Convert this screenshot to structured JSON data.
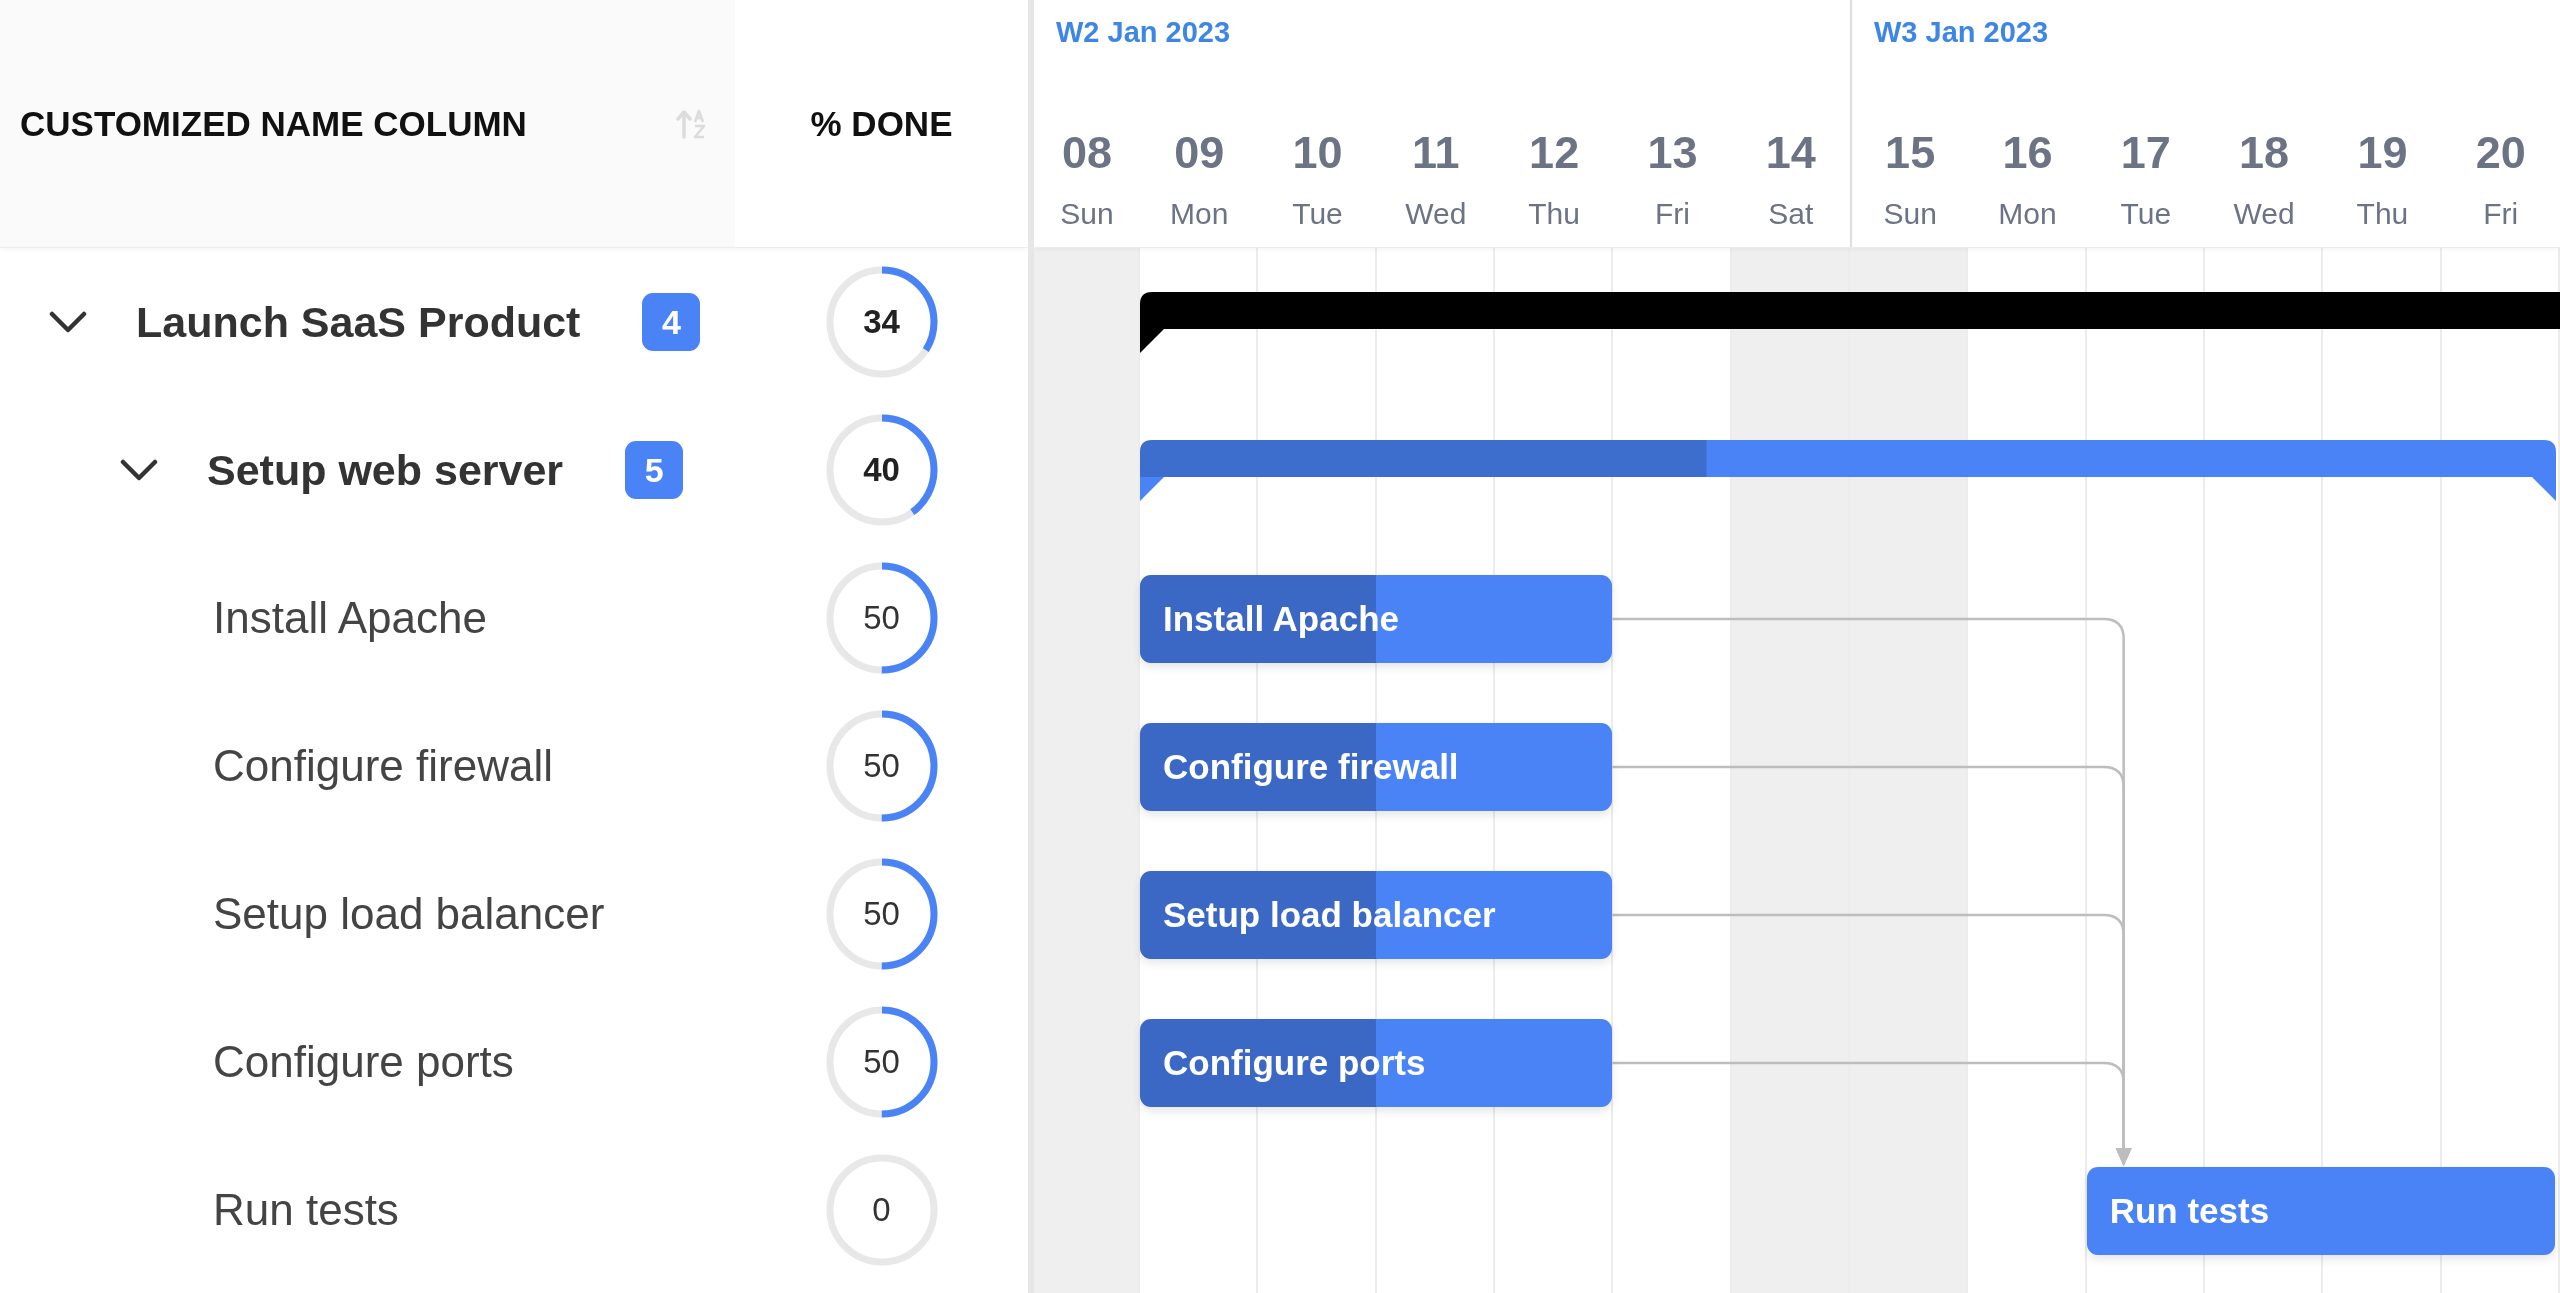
{
  "columns": [
    {
      "label": "CUSTOMIZED NAME COLUMN"
    },
    {
      "label": "% DONE"
    }
  ],
  "rows": [
    {
      "name": "Launch SaaS Product",
      "expanded": true,
      "count": "4",
      "done": "34",
      "level": 0.34,
      "children": [
        {
          "name": "Setup web server",
          "expanded": true,
          "count": "5",
          "done": "40",
          "level": 0.4,
          "children": [
            {
              "name": "Install Apache",
              "done": "50",
              "level": 0.5
            },
            {
              "name": "Configure firewall",
              "done": "50",
              "level": 0.5
            },
            {
              "name": "Setup load balancer",
              "done": "50",
              "level": 0.5
            },
            {
              "name": "Configure ports",
              "done": "50",
              "level": 0.5
            },
            {
              "name": "Run tests",
              "done": "0",
              "level": 0
            }
          ]
        }
      ]
    }
  ],
  "timeline": {
    "weeks": [
      {
        "label": "W2 Jan 2023",
        "days": [
          {
            "number": "08",
            "name": "Sun",
            "weekend": true
          },
          {
            "number": "09",
            "name": "Mon",
            "weekend": false
          },
          {
            "number": "10",
            "name": "Tue",
            "weekend": false
          },
          {
            "number": "11",
            "name": "Wed",
            "weekend": false
          },
          {
            "number": "12",
            "name": "Thu",
            "weekend": false
          },
          {
            "number": "13",
            "name": "Fri",
            "weekend": false
          },
          {
            "number": "14",
            "name": "Sat",
            "weekend": true
          }
        ]
      },
      {
        "label": "W3 Jan 2023",
        "days": [
          {
            "number": "15",
            "name": "Sun",
            "weekend": true
          },
          {
            "number": "16",
            "name": "Mon",
            "weekend": false
          },
          {
            "number": "17",
            "name": "Tue",
            "weekend": false
          },
          {
            "number": "18",
            "name": "Wed",
            "weekend": false
          },
          {
            "number": "19",
            "name": "Thu",
            "weekend": false
          },
          {
            "number": "20",
            "name": "Fri",
            "weekend": false
          }
        ]
      }
    ]
  },
  "bars": [
    {
      "kind": "summary",
      "color": "#000000",
      "linked": false
    },
    {
      "kind": "summary",
      "color": "#4a83f5",
      "level": 0.4,
      "linked": false
    },
    {
      "kind": "task",
      "color": "#4a83f5",
      "label": "Install Apache",
      "level": 0.5,
      "linked": true
    },
    {
      "kind": "task",
      "color": "#4a83f5",
      "label": "Configure firewall",
      "level": 0.5,
      "linked": true
    },
    {
      "kind": "task",
      "color": "#4a83f5",
      "label": "Setup load balancer",
      "level": 0.5,
      "linked": true
    },
    {
      "kind": "task",
      "color": "#4a83f5",
      "label": "Configure ports",
      "level": 0.5,
      "linked": true
    },
    {
      "kind": "task",
      "color": "#4a83f5",
      "label": "Run tests",
      "level": 0,
      "linked": false
    }
  ]
}
